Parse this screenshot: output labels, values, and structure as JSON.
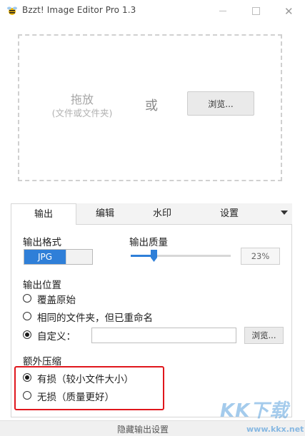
{
  "window": {
    "title": "Bzzt! Image Editor Pro 1.3",
    "close_glyph": "✕"
  },
  "dropzone": {
    "drag_label": "拖放",
    "drag_sub": "(文件或文件夹)",
    "or_label": "或",
    "browse_label": "浏览..."
  },
  "tabs": [
    {
      "label": "输出",
      "active": true
    },
    {
      "label": "编辑",
      "active": false
    },
    {
      "label": "水印",
      "active": false
    },
    {
      "label": "设置",
      "active": false
    }
  ],
  "output": {
    "format_label": "输出格式",
    "format_value": "JPG",
    "quality_label": "输出质量",
    "quality_value": "23%",
    "quality_fraction": 0.23,
    "location_label": "输出位置",
    "location_options": [
      {
        "label": "覆盖原始",
        "checked": false
      },
      {
        "label": "相同的文件夹，但已重命名",
        "checked": false
      },
      {
        "label": "自定义：",
        "checked": true
      }
    ],
    "custom_path_value": "",
    "browse_label": "浏览...",
    "extra_label": "额外压缩",
    "compression_options": [
      {
        "label": "有损（较小文件大小）",
        "checked": true
      },
      {
        "label": "无损（质量更好）",
        "checked": false
      }
    ]
  },
  "footer": {
    "hide_settings_label": "隐藏输出设置"
  },
  "watermark": {
    "logo_text": "KK下载",
    "url_text": "www.kkx.net"
  },
  "colors": {
    "accent": "#2f7fd8",
    "highlight": "#e0161c"
  }
}
